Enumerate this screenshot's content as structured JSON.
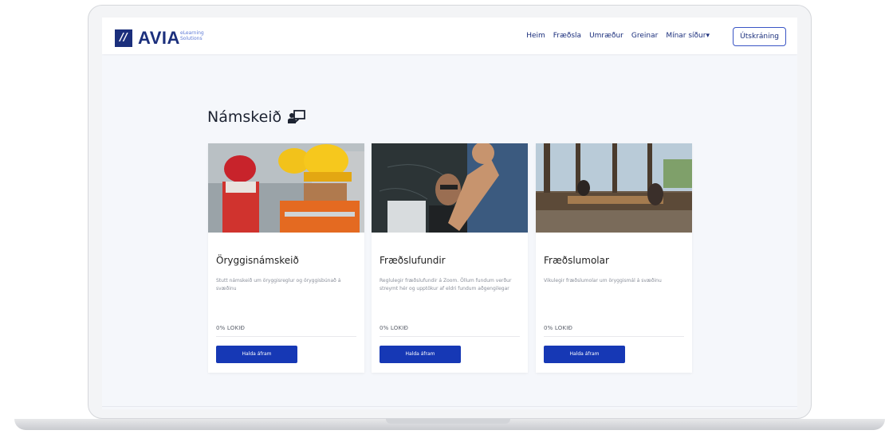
{
  "brand": {
    "name": "AVIA",
    "subtitle": "eLearning Solutions",
    "colors": {
      "primary": "#1b2f7c",
      "button": "#1638b5"
    }
  },
  "nav": {
    "links": [
      "Heim",
      "Fræðsla",
      "Umræður",
      "Greinar",
      "Mínar síður"
    ],
    "dropdown_caret": "▾",
    "logout_label": "Útskráning"
  },
  "page": {
    "title": "Námskeið",
    "title_icon": "teacher-icon"
  },
  "courses": [
    {
      "title": "Öryggisnámskeið",
      "description": "Stutt námskeið um öryggisreglur og öryggisbúnað á svæðinu",
      "progress": "0% LOKIÐ",
      "progress_value": 0,
      "button_label": "Halda áfram",
      "image": "construction-workers-photo"
    },
    {
      "title": "Fræðslufundir",
      "description": "Reglulegir fræðslufundir á Zoom. Öllum fundum verður streymt hér og upptökur af eldri fundum aðgengilegar",
      "progress": "0% LOKIÐ",
      "progress_value": 0,
      "button_label": "Halda áfram",
      "image": "laptop-meeting-photo"
    },
    {
      "title": "Fræðslumolar",
      "description": "Vikulegir fræðslumolar um öryggismál á svæðinu",
      "progress": "0% LOKIÐ",
      "progress_value": 0,
      "button_label": "Halda áfram",
      "image": "office-workspace-photo"
    }
  ]
}
